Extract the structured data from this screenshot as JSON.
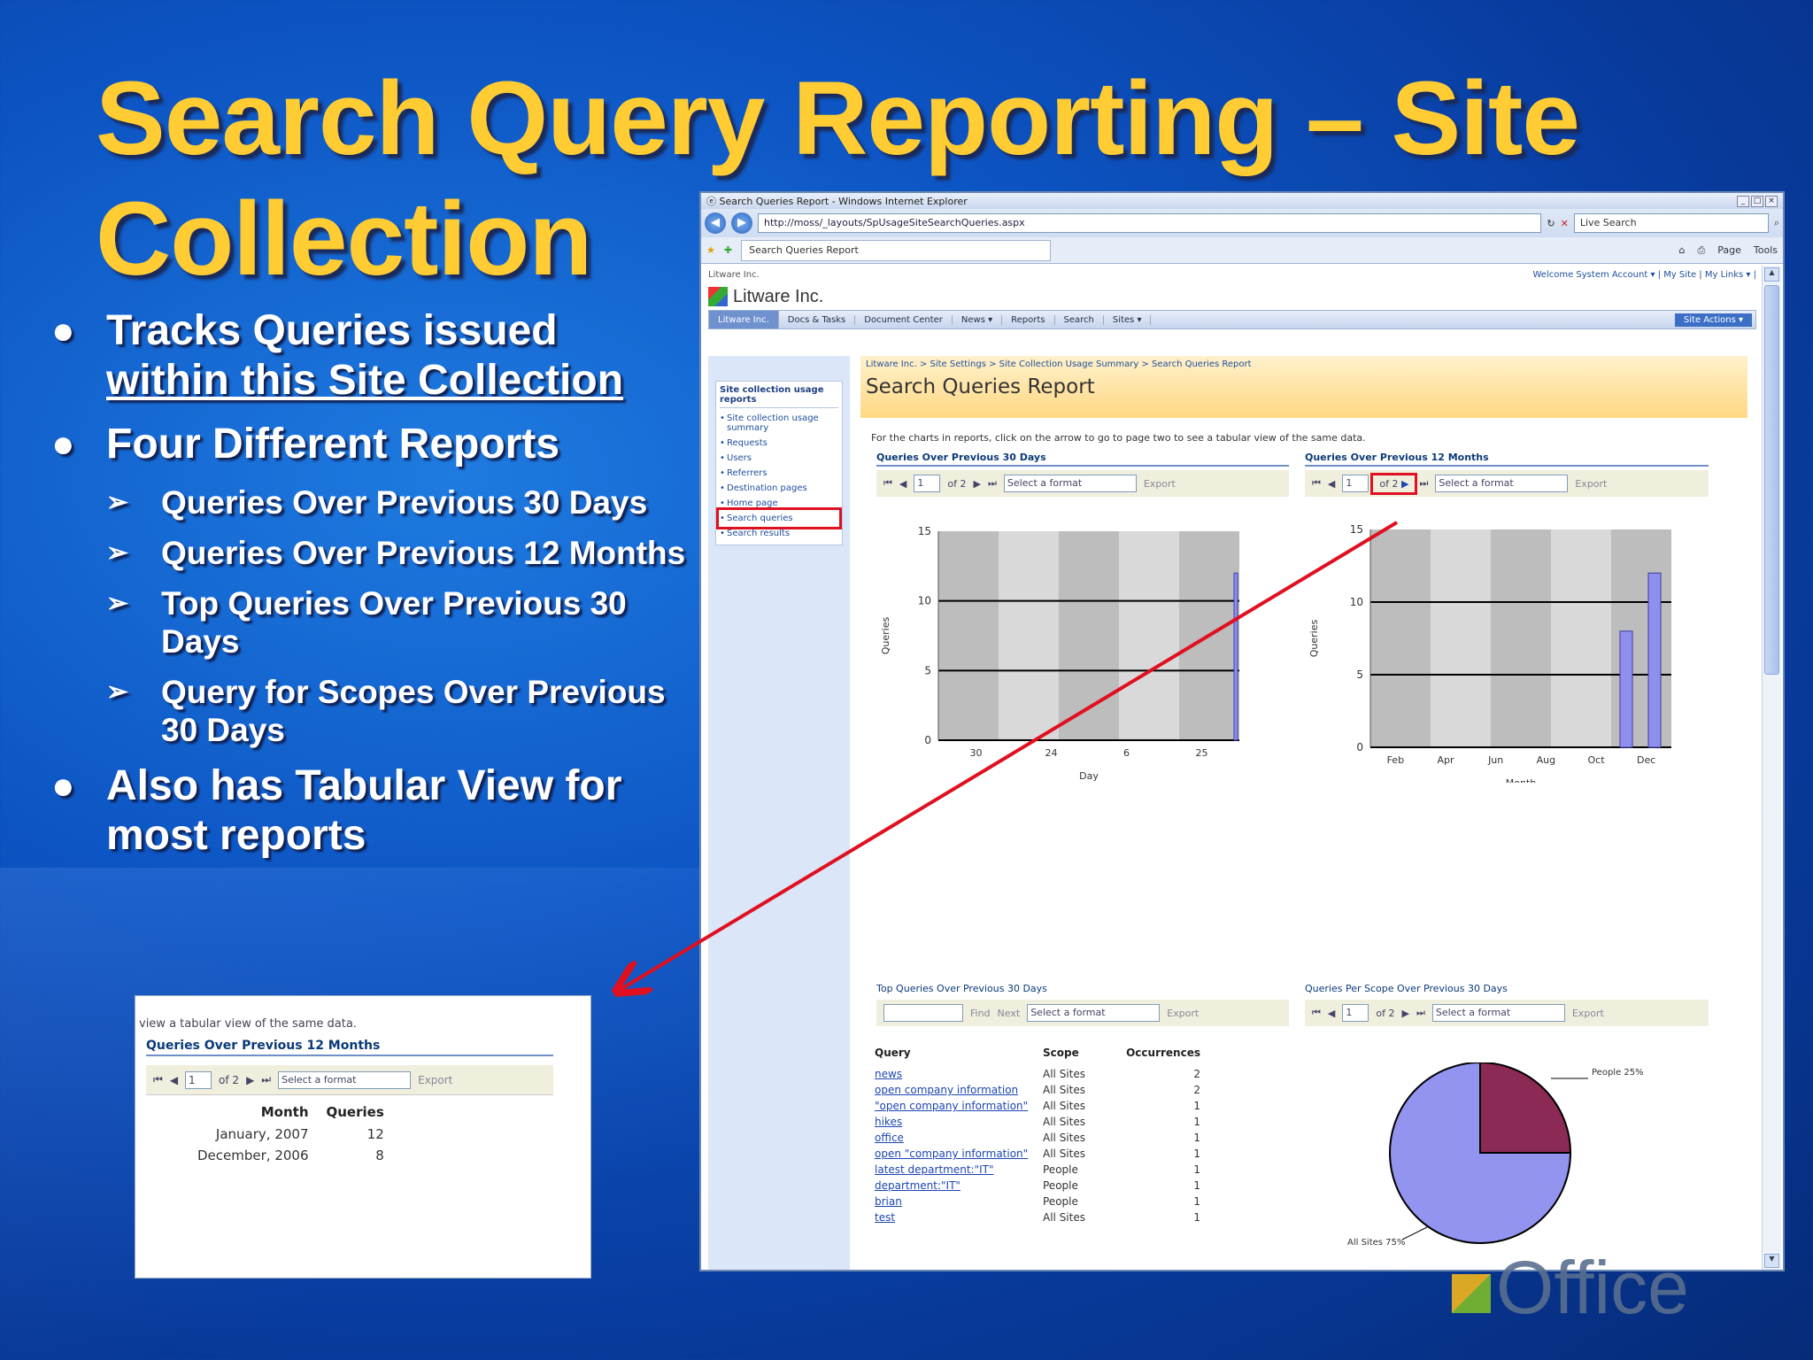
{
  "slide": {
    "title_line1": "Search Query Reporting – Site",
    "title_line2": "Collection",
    "bullets": [
      {
        "text": "Tracks Queries issued",
        "text2": "within this Site Collection"
      },
      {
        "text": "Four Different Reports"
      },
      {
        "text": "Also has Tabular View for most reports"
      }
    ],
    "sub_bullets": [
      "Queries Over Previous 30 Days",
      "Queries Over Previous 12 Months",
      "Top Queries Over Previous 30 Days",
      "Query for Scopes Over Previous 30 Days"
    ],
    "office_text": "Office"
  },
  "inset": {
    "desc": "view a tabular view of the same data.",
    "header": "Queries Over Previous 12 Months",
    "pager": {
      "page": "1",
      "of": "of 2",
      "format": "Select a format",
      "export": "Export"
    },
    "columns": [
      "Month",
      "Queries"
    ],
    "rows": [
      [
        "January, 2007",
        "12"
      ],
      [
        "December, 2006",
        "8"
      ]
    ]
  },
  "browser": {
    "title": "Search Queries Report - Windows Internet Explorer",
    "url": "http://moss/_layouts/SpUsageSiteSearchQueries.aspx",
    "search_placeholder": "Live Search",
    "tab": "Search Queries Report",
    "tools": [
      "Page",
      "Tools"
    ],
    "welcome_left": "Litware Inc.",
    "welcome_right": "Welcome System Account ▾ | My Site | My Links ▾ |",
    "brand": "Litware Inc.",
    "nav_tabs": [
      "Litware Inc.",
      "Docs & Tasks",
      "Document Center",
      "News ▾",
      "Reports",
      "Search",
      "Sites ▾"
    ],
    "site_actions": "Site Actions ▾",
    "left_nav_title": "Site collection usage reports",
    "left_nav_items": [
      "Site collection usage summary",
      "Requests",
      "Users",
      "Referrers",
      "Destination pages",
      "Home page",
      "Search queries",
      "Search results"
    ],
    "breadcrumb": "Litware Inc. > Site Settings > Site Collection Usage Summary > Search Queries Report",
    "page_title": "Search Queries Report",
    "intro": "For the charts in reports, click on the arrow to go to page two to see a tabular view of the same data.",
    "panels": {
      "q30": {
        "header": "Queries Over Previous 30 Days",
        "page": "1",
        "of": "of 2",
        "format": "Select a format",
        "export": "Export"
      },
      "q12": {
        "header": "Queries Over Previous 12 Months",
        "page": "1",
        "of": "of 2",
        "format": "Select a format",
        "export": "Export"
      },
      "top": {
        "header": "Top Queries Over Previous 30 Days",
        "find": "Find",
        "next": "Next",
        "format": "Select a format",
        "export": "Export"
      },
      "scope": {
        "header": "Queries Per Scope Over Previous 30 Days",
        "page": "1",
        "of": "of 2",
        "format": "Select a format",
        "export": "Export"
      }
    },
    "table": {
      "columns": [
        "Query",
        "Scope",
        "Occurrences"
      ],
      "rows": [
        [
          "news",
          "All Sites",
          "2"
        ],
        [
          "open company information",
          "All Sites",
          "2"
        ],
        [
          "\"open company information\"",
          "All Sites",
          "1"
        ],
        [
          "hikes",
          "All Sites",
          "1"
        ],
        [
          "office",
          "All Sites",
          "1"
        ],
        [
          "open \"company information\"",
          "All Sites",
          "1"
        ],
        [
          "latest department:\"IT\"",
          "People",
          "1"
        ],
        [
          "department:\"IT\"",
          "People",
          "1"
        ],
        [
          "brian",
          "People",
          "1"
        ],
        [
          "test",
          "All Sites",
          "1"
        ]
      ]
    }
  },
  "chart_data": [
    {
      "type": "bar",
      "title": "Queries Over Previous 30 Days",
      "ylabel": "Queries",
      "xlabel": "Day",
      "ylim": [
        0,
        15
      ],
      "yticks": [
        "0",
        "5",
        "10",
        "15"
      ],
      "xticks": [
        "30",
        "24",
        "6",
        "25"
      ],
      "categories": [
        "30",
        "24",
        "6",
        "25"
      ],
      "values": [
        0,
        0,
        0,
        12
      ]
    },
    {
      "type": "bar",
      "title": "Queries Over Previous 12 Months",
      "ylabel": "Queries",
      "xlabel": "Month",
      "ylim": [
        0,
        15
      ],
      "yticks": [
        "0",
        "5",
        "10",
        "15"
      ],
      "xticks": [
        "Feb",
        "Apr",
        "Jun",
        "Aug",
        "Oct",
        "Dec"
      ],
      "categories": [
        "December, 2006",
        "January, 2007"
      ],
      "values": [
        8,
        12
      ]
    },
    {
      "type": "pie",
      "title": "Queries Per Scope Over Previous 30 Days",
      "series": [
        {
          "name": "People",
          "label": "People 25%",
          "value": 25
        },
        {
          "name": "All Sites",
          "label": "All Sites 75%",
          "value": 75
        }
      ],
      "colors": [
        "#8b2a55",
        "#9393f0"
      ]
    }
  ]
}
